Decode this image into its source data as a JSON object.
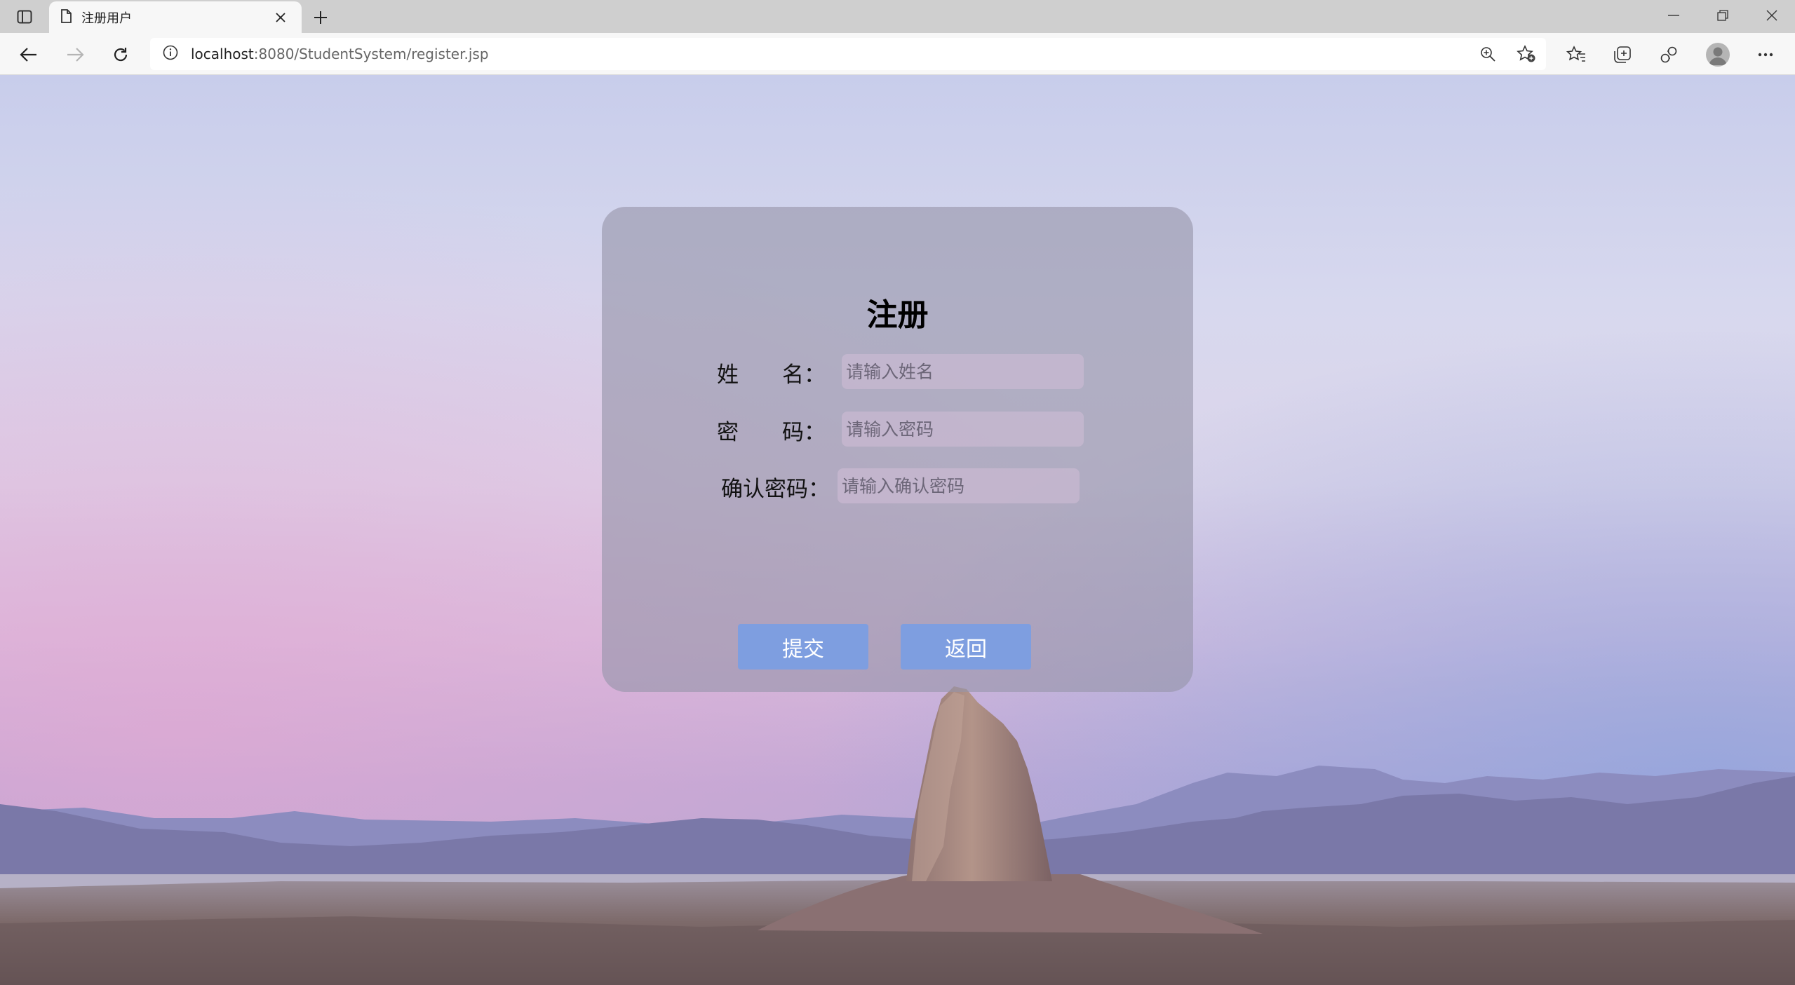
{
  "browser": {
    "tab_title": "注册用户",
    "url_host": "localhost",
    "url_rest": ":8080/StudentSystem/register.jsp"
  },
  "form": {
    "title": "注册",
    "name_label": "姓　　名：",
    "name_placeholder": "请输入姓名",
    "password_label": "密　　码：",
    "password_placeholder": "请输入密码",
    "confirm_label": "确认密码：",
    "confirm_placeholder": "请输入确认密码",
    "submit_label": "提交",
    "back_label": "返回"
  },
  "colors": {
    "button": "#7e9ee0",
    "card": "rgba(150,148,170,0.62)",
    "sky_top": "#c9cdec",
    "sky_horizon": "#c9a9d6"
  },
  "icons": [
    "tab-actions-icon",
    "page-icon",
    "close-icon",
    "plus-icon",
    "minimize-icon",
    "restore-icon",
    "window-close-icon",
    "back-arrow-icon",
    "forward-arrow-icon",
    "refresh-icon",
    "info-icon",
    "zoom-icon",
    "add-favorite-icon",
    "favorites-icon",
    "collections-icon",
    "extensions-icon",
    "profile-icon",
    "more-icon"
  ]
}
